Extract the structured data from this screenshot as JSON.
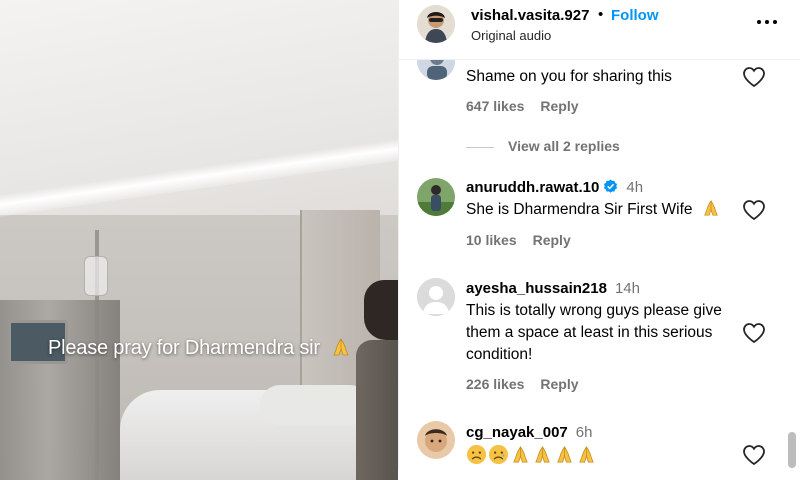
{
  "video": {
    "caption": "Please pray for Dharmendra sir"
  },
  "header": {
    "username": "vishal.vasita.927",
    "separator": "•",
    "follow_label": "Follow",
    "subtitle": "Original audio"
  },
  "comments": [
    {
      "username": "",
      "time": "",
      "text": "Shame on you for sharing this",
      "likes": "647 likes",
      "reply_label": "Reply"
    },
    {
      "username": "anuruddh.rawat.10",
      "verified": true,
      "time": "4h",
      "text": "She is Dharmendra Sir First Wife",
      "likes": "10 likes",
      "reply_label": "Reply"
    },
    {
      "username": "ayesha_hussain218",
      "time": "14h",
      "text": "This is totally wrong guys please give them a space at least in this serious condition!",
      "likes": "226 likes",
      "reply_label": "Reply"
    },
    {
      "username": "cg_nayak_007",
      "time": "6h",
      "emojis": [
        "sad-face",
        "sad-face",
        "folded-hands",
        "folded-hands",
        "folded-hands",
        "folded-hands"
      ]
    }
  ],
  "view_replies_label": "View all 2 replies",
  "colors": {
    "accent": "#0095f6",
    "secondary_text": "#737373",
    "verified": "#0095f6"
  }
}
